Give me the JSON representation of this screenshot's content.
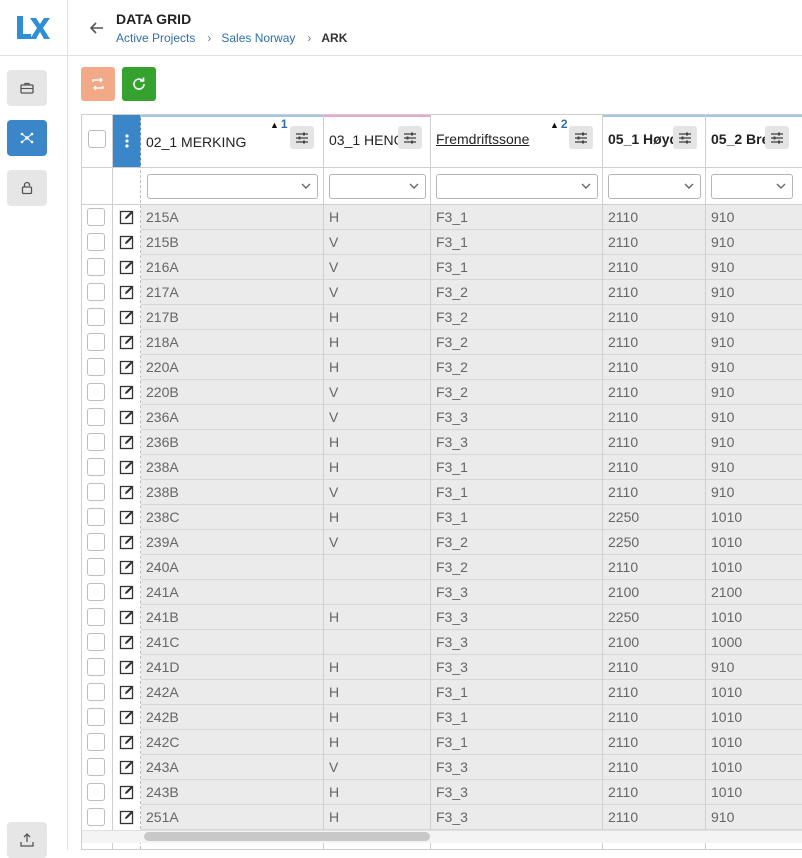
{
  "header": {
    "title": "DATA GRID",
    "breadcrumbs": [
      "Active Projects",
      "Sales Norway"
    ],
    "current": "ARK"
  },
  "rail": {
    "items": [
      {
        "icon": "briefcase-icon",
        "active": false
      },
      {
        "icon": "network-nodes-icon",
        "active": true
      },
      {
        "icon": "lock-icon",
        "active": false
      }
    ],
    "bottom_icon": "tray-export-icon"
  },
  "toolbar": {
    "buttons": [
      {
        "icon": "transfer-icon",
        "color": "#f2a987"
      },
      {
        "icon": "refresh-icon",
        "color": "#35a22f"
      }
    ]
  },
  "grid": {
    "columns": [
      {
        "label": "02_1 MERKING",
        "sort_order": "1",
        "sort_dir": "asc"
      },
      {
        "label": "03_1 HENG"
      },
      {
        "label": "Fremdriftssone",
        "sort_order": "2",
        "sort_dir": "asc"
      },
      {
        "label": "05_1 Høyd"
      },
      {
        "label": "05_2 Bre"
      }
    ],
    "rows": [
      [
        "215A",
        "H",
        "F3_1",
        "2110",
        "910"
      ],
      [
        "215B",
        "V",
        "F3_1",
        "2110",
        "910"
      ],
      [
        "216A",
        "V",
        "F3_1",
        "2110",
        "910"
      ],
      [
        "217A",
        "V",
        "F3_2",
        "2110",
        "910"
      ],
      [
        "217B",
        "H",
        "F3_2",
        "2110",
        "910"
      ],
      [
        "218A",
        "H",
        "F3_2",
        "2110",
        "910"
      ],
      [
        "220A",
        "H",
        "F3_2",
        "2110",
        "910"
      ],
      [
        "220B",
        "V",
        "F3_2",
        "2110",
        "910"
      ],
      [
        "236A",
        "V",
        "F3_3",
        "2110",
        "910"
      ],
      [
        "236B",
        "H",
        "F3_3",
        "2110",
        "910"
      ],
      [
        "238A",
        "H",
        "F3_1",
        "2110",
        "910"
      ],
      [
        "238B",
        "V",
        "F3_1",
        "2110",
        "910"
      ],
      [
        "238C",
        "H",
        "F3_1",
        "2250",
        "1010"
      ],
      [
        "239A",
        "V",
        "F3_2",
        "2250",
        "1010"
      ],
      [
        "240A",
        "",
        "F3_2",
        "2110",
        "1010"
      ],
      [
        "241A",
        "",
        "F3_3",
        "2100",
        "2100"
      ],
      [
        "241B",
        "H",
        "F3_3",
        "2250",
        "1010"
      ],
      [
        "241C",
        "",
        "F3_3",
        "2100",
        "1000"
      ],
      [
        "241D",
        "H",
        "F3_3",
        "2110",
        "910"
      ],
      [
        "242A",
        "H",
        "F3_1",
        "2110",
        "1010"
      ],
      [
        "242B",
        "H",
        "F3_1",
        "2110",
        "1010"
      ],
      [
        "242C",
        "H",
        "F3_1",
        "2110",
        "1010"
      ],
      [
        "243A",
        "V",
        "F3_3",
        "2110",
        "1010"
      ],
      [
        "243B",
        "H",
        "F3_3",
        "2110",
        "1010"
      ],
      [
        "251A",
        "H",
        "F3_3",
        "2110",
        "910"
      ]
    ]
  },
  "colors": {
    "accent": "#3b86c9",
    "link": "#2f6fb1",
    "refresh": "#35a22f",
    "transfer": "#f2a987"
  }
}
